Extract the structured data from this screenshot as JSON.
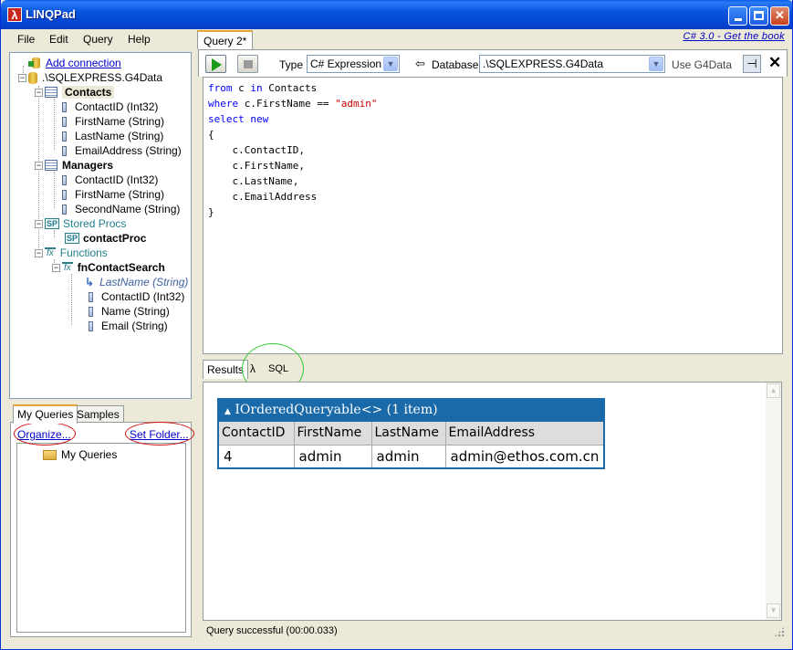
{
  "window": {
    "title": "LINQPad",
    "icon_symbol": "λ",
    "controls": {
      "minimize": "minimize",
      "maximize": "maximize",
      "close": "✕"
    }
  },
  "menu": [
    "File",
    "Edit",
    "Query",
    "Help"
  ],
  "tree": {
    "add_connection": "Add connection",
    "server": ".\\SQLEXPRESS.G4Data",
    "tables": [
      {
        "name": "Contacts",
        "columns": [
          "ContactID (Int32)",
          "FirstName (String)",
          "LastName (String)",
          "EmailAddress (String)"
        ]
      },
      {
        "name": "Managers",
        "columns": [
          "ContactID (Int32)",
          "FirstName (String)",
          "SecondName (String)"
        ]
      }
    ],
    "stored_procs_label": "Stored Procs",
    "stored_proc": "contactProc",
    "functions_label": "Functions",
    "function": {
      "name": "fnContactSearch",
      "parameter": "LastName (String)",
      "columns": [
        "ContactID (Int32)",
        "Name (String)",
        "Email (String)"
      ]
    },
    "icons": {
      "sp": "SP",
      "fx": "fx",
      "collapse": "−",
      "param_arrow": "↳"
    }
  },
  "queries_panel": {
    "tabs": [
      "My Queries",
      "Samples"
    ],
    "organize_link": "Organize...",
    "set_folder_link": "Set Folder...",
    "folder": "My Queries"
  },
  "document": {
    "tab_label": "Query 2*",
    "top_link": "C# 3.0 - Get the book"
  },
  "toolbar": {
    "type_label": "Type",
    "type_value": "C# Expression",
    "database_arrow": "⇦",
    "database_label": "Database",
    "database_value": ".\\SQLEXPRESS.G4Data",
    "use_db_label": "Use G4Data",
    "close_symbol": "✕",
    "pin_symbol": "⊣",
    "dropdown_arrow": "▼"
  },
  "code": {
    "lines": [
      [
        {
          "t": "from",
          "k": "kw"
        },
        {
          "t": " c ",
          "k": ""
        },
        {
          "t": "in",
          "k": "kw"
        },
        {
          "t": " Contacts",
          "k": ""
        }
      ],
      [
        {
          "t": "where",
          "k": "kw"
        },
        {
          "t": " c.FirstName == ",
          "k": ""
        },
        {
          "t": "\"admin\"",
          "k": "str"
        }
      ],
      [
        {
          "t": "select",
          "k": "kw"
        },
        {
          "t": " ",
          "k": ""
        },
        {
          "t": "new",
          "k": "kw"
        }
      ],
      [
        {
          "t": "{",
          "k": ""
        }
      ],
      [
        {
          "t": "    c.ContactID,",
          "k": ""
        }
      ],
      [
        {
          "t": "    c.FirstName,",
          "k": ""
        }
      ],
      [
        {
          "t": "    c.LastName,",
          "k": ""
        }
      ],
      [
        {
          "t": "    c.EmailAddress",
          "k": ""
        }
      ],
      [
        {
          "t": "}",
          "k": ""
        }
      ]
    ]
  },
  "results_tabs": {
    "results": "Results",
    "lambda": "λ",
    "sql": "SQL"
  },
  "results": {
    "caption_arrow": "▲",
    "caption": "IOrderedQueryable<> (1 item)",
    "columns": [
      "ContactID",
      "FirstName",
      "LastName",
      "EmailAddress"
    ],
    "rows": [
      [
        "4",
        "admin",
        "admin",
        "admin@ethos.com.cn"
      ]
    ]
  },
  "status": {
    "message": "Query successful  (00:00.033)"
  },
  "scroll_arrows": {
    "up": "▲",
    "down": "▼"
  }
}
